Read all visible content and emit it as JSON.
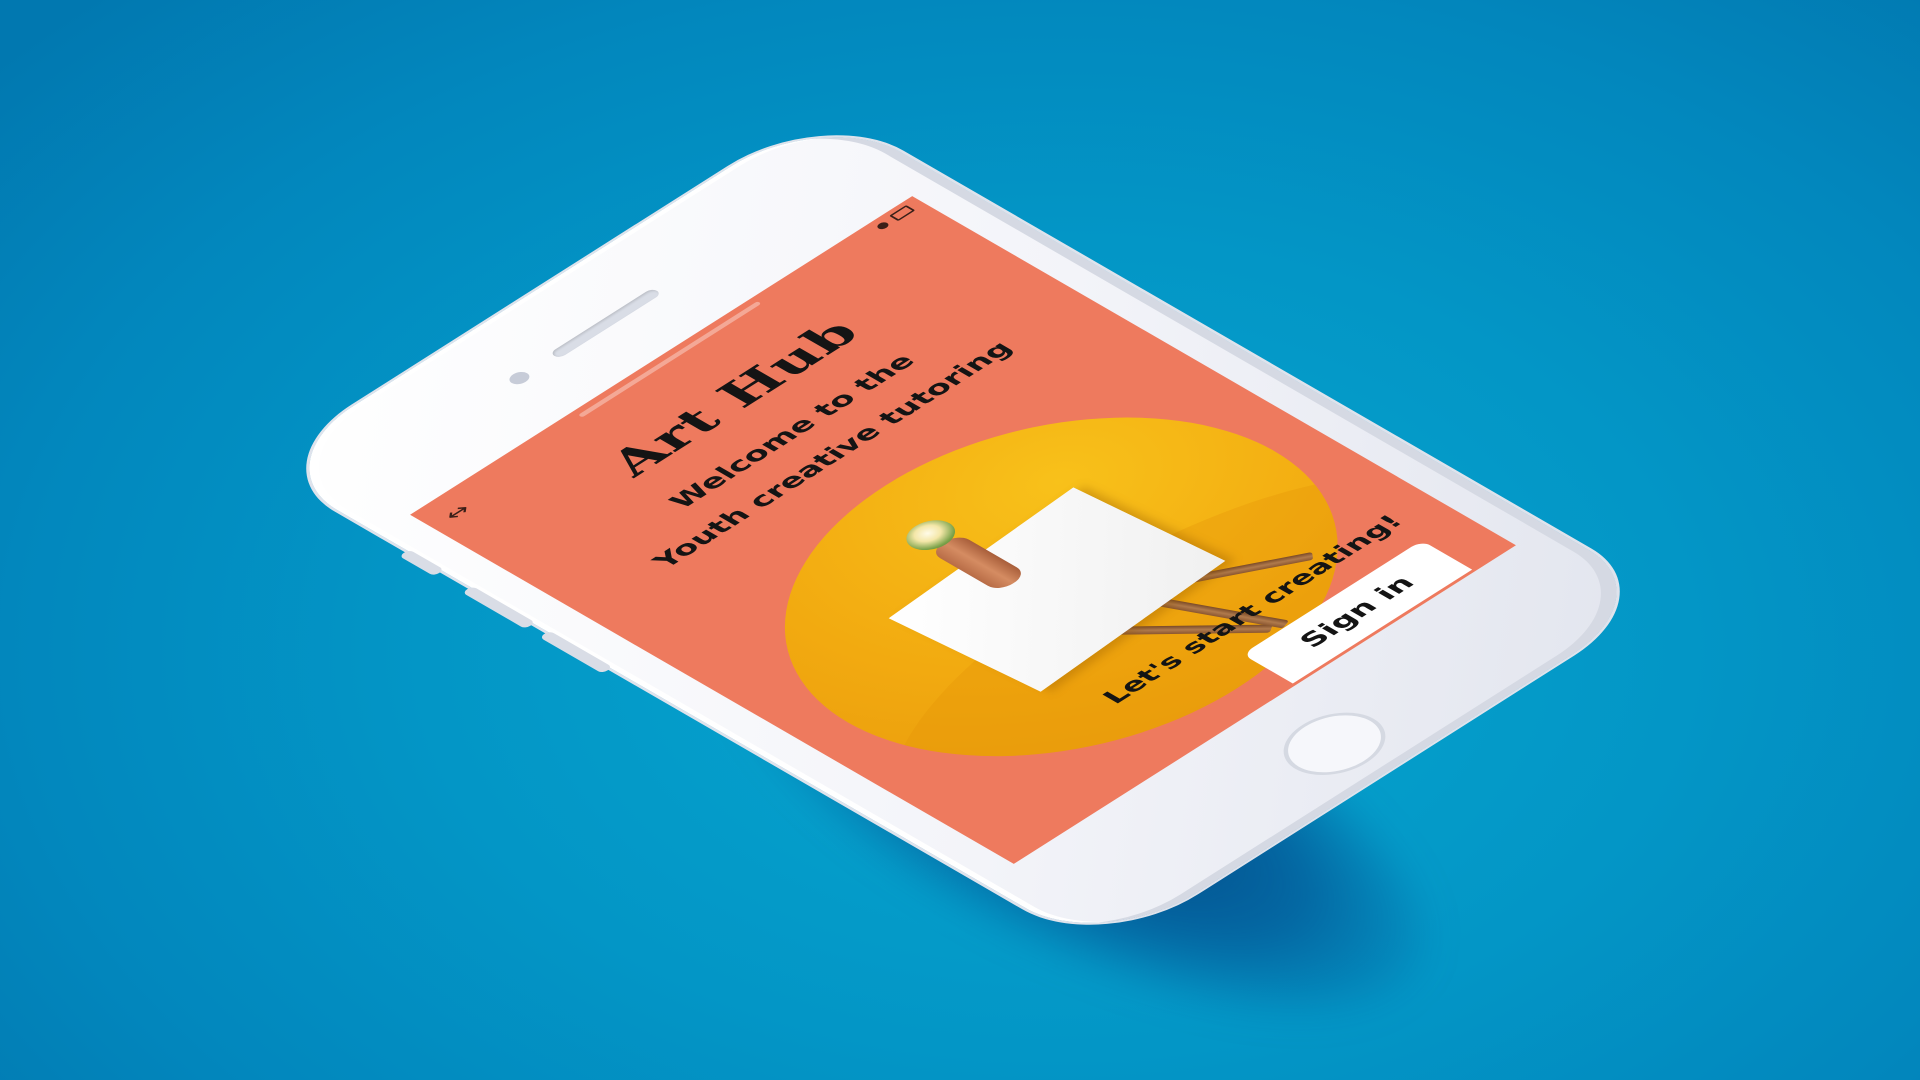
{
  "app": {
    "title": "Art Hub",
    "subtitle_line1": "Welcome to the",
    "subtitle_line2": "Youth creative tutoring",
    "cta_text": "Let's start creating!",
    "signin_label": "Sign in"
  },
  "nav": {
    "back_icon": "back-arrow-icon"
  },
  "status_bar": {
    "icons": [
      "signal-icon",
      "battery-icon"
    ]
  },
  "hero_image": {
    "subject": "easel-with-hand-holding-flower"
  },
  "colors": {
    "background": "#0396c6",
    "screen": "#ee7a5e",
    "hero": "#f2aa10",
    "text": "#141414",
    "button": "#ffffff"
  }
}
